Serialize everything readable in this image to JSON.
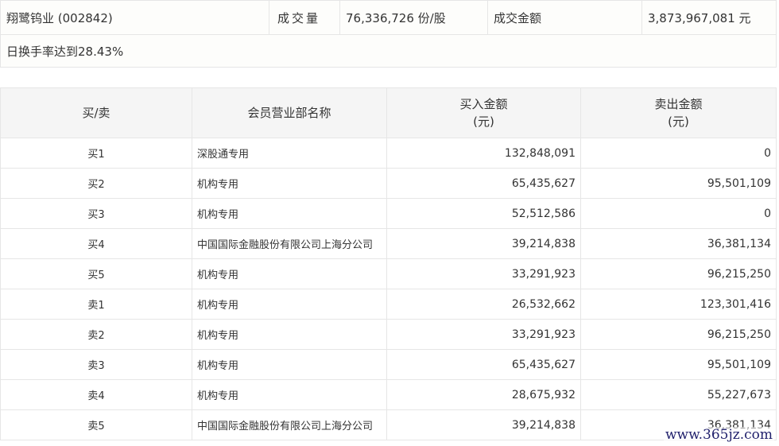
{
  "summary": {
    "stock_name": "翔鹭钨业 (002842)",
    "volume_label": "成交量",
    "volume_value": "76,336,726 份/股",
    "amount_label": "成交金额",
    "amount_value": "3,873,967,081 元",
    "turnover_text": "日换手率达到28.43%"
  },
  "table": {
    "headers": {
      "side": "买/卖",
      "member": "会员营业部名称",
      "buy_amount": "买入金额",
      "buy_unit": "(元)",
      "sell_amount": "卖出金额",
      "sell_unit": "(元)"
    },
    "rows": [
      {
        "side": "买1",
        "name": "深股通专用",
        "buy": "132,848,091",
        "sell": "0"
      },
      {
        "side": "买2",
        "name": "机构专用",
        "buy": "65,435,627",
        "sell": "95,501,109"
      },
      {
        "side": "买3",
        "name": "机构专用",
        "buy": "52,512,586",
        "sell": "0"
      },
      {
        "side": "买4",
        "name": "中国国际金融股份有限公司上海分公司",
        "buy": "39,214,838",
        "sell": "36,381,134"
      },
      {
        "side": "买5",
        "name": "机构专用",
        "buy": "33,291,923",
        "sell": "96,215,250"
      },
      {
        "side": "卖1",
        "name": "机构专用",
        "buy": "26,532,662",
        "sell": "123,301,416"
      },
      {
        "side": "卖2",
        "name": "机构专用",
        "buy": "33,291,923",
        "sell": "96,215,250"
      },
      {
        "side": "卖3",
        "name": "机构专用",
        "buy": "65,435,627",
        "sell": "95,501,109"
      },
      {
        "side": "卖4",
        "name": "机构专用",
        "buy": "28,675,932",
        "sell": "55,227,673"
      },
      {
        "side": "卖5",
        "name": "中国国际金融股份有限公司上海分公司",
        "buy": "39,214,838",
        "sell": "36,381,134"
      }
    ]
  },
  "watermark": "www.365jz.com"
}
